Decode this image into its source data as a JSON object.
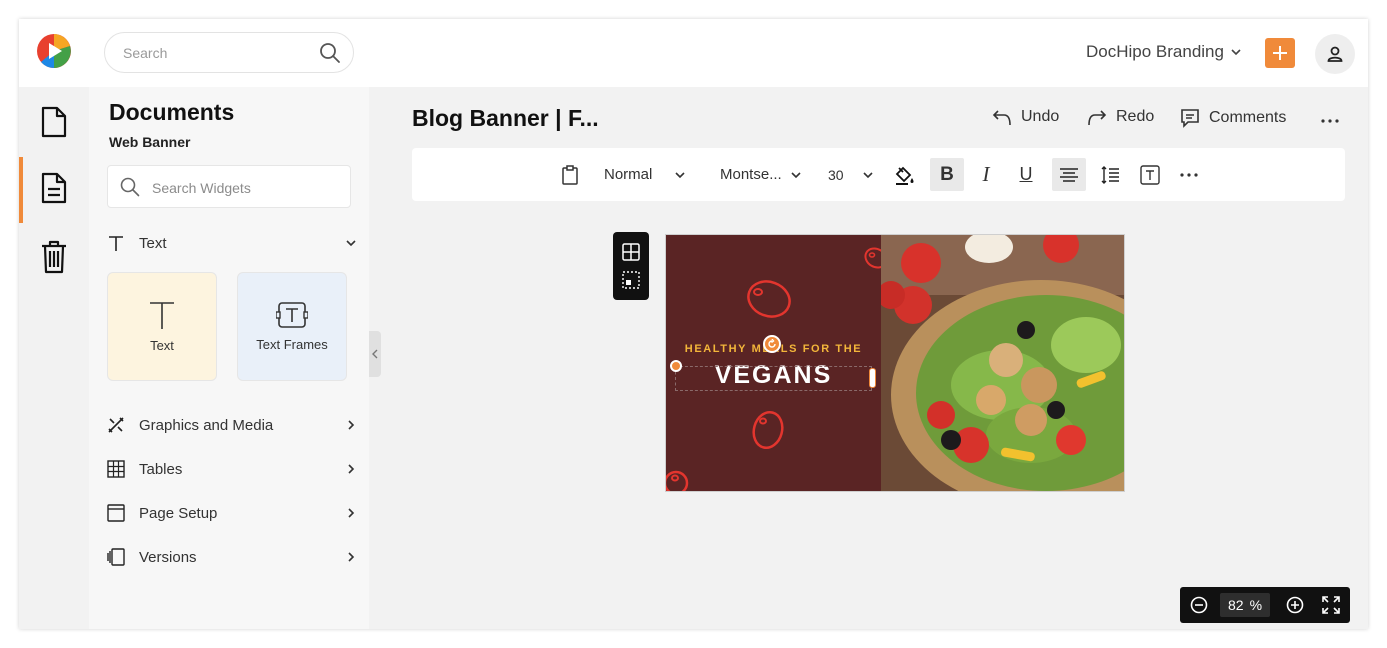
{
  "app": {
    "logo_icon": "dochipo-logo-icon",
    "search_placeholder": "Search",
    "brand_label": "DocHipo Branding",
    "accent_color": "#f08a3a"
  },
  "rail": {
    "items": [
      {
        "name": "documents",
        "icon": "file-icon",
        "active": false
      },
      {
        "name": "document-detail",
        "icon": "file-text-icon",
        "active": true
      },
      {
        "name": "trash",
        "icon": "trash-icon",
        "active": false
      }
    ]
  },
  "panel": {
    "title": "Documents",
    "subtitle": "Web Banner",
    "search_placeholder": "Search Widgets",
    "text_section": "Text",
    "widgets": [
      {
        "label": "Text",
        "icon": "text-t-icon"
      },
      {
        "label": "Text Frames",
        "icon": "text-frame-icon"
      }
    ],
    "sections": [
      {
        "label": "Graphics and Media",
        "icon": "graphics-icon"
      },
      {
        "label": "Tables",
        "icon": "table-icon"
      },
      {
        "label": "Page Setup",
        "icon": "page-setup-icon"
      },
      {
        "label": "Versions",
        "icon": "versions-icon"
      }
    ]
  },
  "editor": {
    "doc_title": "Blog Banner | F...",
    "undo_label": "Undo",
    "redo_label": "Redo",
    "comments_label": "Comments"
  },
  "toolbar": {
    "style_value": "Normal",
    "font_value": "Montse...",
    "size_value": "30",
    "bold": "B",
    "italic": "I",
    "underline": "U"
  },
  "canvas": {
    "subheading": "HEALTHY MEALS FOR THE",
    "heading": "VEGANS",
    "bg_color": "#5a2424",
    "sub_color": "#f3b63a"
  },
  "zoom": {
    "value": "82",
    "unit": "%"
  }
}
